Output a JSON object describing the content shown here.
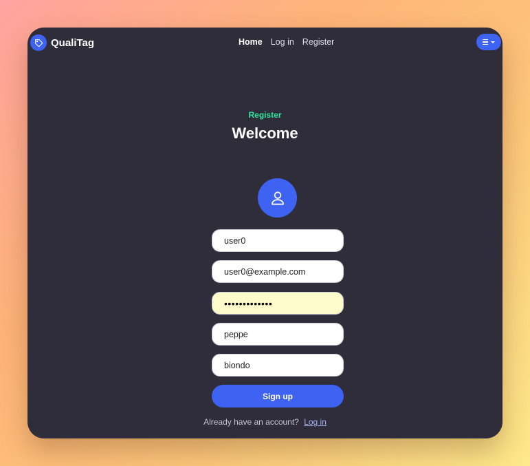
{
  "nav": {
    "brand": "QualiTag",
    "links": [
      {
        "label": "Home",
        "active": true
      },
      {
        "label": "Log in",
        "active": false
      },
      {
        "label": "Register",
        "active": false
      }
    ],
    "menu_icon": "hamburger-menu-icon"
  },
  "page": {
    "eyebrow": "Register",
    "title": "Welcome",
    "avatar_icon": "user-icon"
  },
  "form": {
    "username": "user0",
    "email": "user0@example.com",
    "password_mask": "•••••••••••••",
    "first_name": "peppe",
    "last_name": "biondo",
    "submit_label": "Sign up"
  },
  "footer": {
    "prompt": "Already have an account?",
    "link": "Log in"
  },
  "colors": {
    "accent": "#3e63f2",
    "eyebrow": "#2ee59d",
    "panel": "#2f2d3a"
  }
}
